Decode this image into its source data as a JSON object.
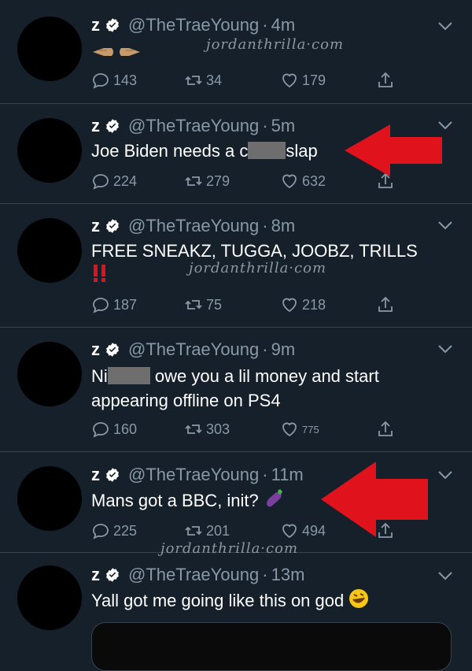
{
  "user": {
    "name": "z",
    "handle": "@TheTraeYoung",
    "separator": "·"
  },
  "tweets": [
    {
      "time": "4m",
      "text": "",
      "replies": "143",
      "retweets": "34",
      "likes": "179"
    },
    {
      "time": "5m",
      "text_before": "Joe Biden needs a c",
      "text_after": "slap",
      "replies": "224",
      "retweets": "279",
      "likes": "632"
    },
    {
      "time": "8m",
      "text": "FREE SNEAKZ, TUGGA, JOOBZ, TRILLS",
      "replies": "187",
      "retweets": "75",
      "likes": "218"
    },
    {
      "time": "9m",
      "text_before": "Ni",
      "text_after": " owe you a lil money and start appearing offline on PS4",
      "replies": "160",
      "retweets": "303",
      "likes": "775"
    },
    {
      "time": "11m",
      "text": "Mans got a BBC, init?",
      "replies": "225",
      "retweets": "201",
      "likes": "494"
    },
    {
      "time": "13m",
      "text": "Yall got me going like this on god"
    }
  ],
  "watermark": "jordanthrilla·com",
  "icons": [
    "verified-badge-icon",
    "chevron-down-icon",
    "reply-icon",
    "retweet-icon",
    "like-icon",
    "share-icon",
    "pointing-hands-emoji",
    "double-exclamation-emoji",
    "eggplant-emoji",
    "rofl-emoji",
    "red-arrow"
  ],
  "colors": {
    "background": "#15202b",
    "muted": "#8899a6",
    "divider": "#38444d",
    "arrow": "#e0121b"
  }
}
